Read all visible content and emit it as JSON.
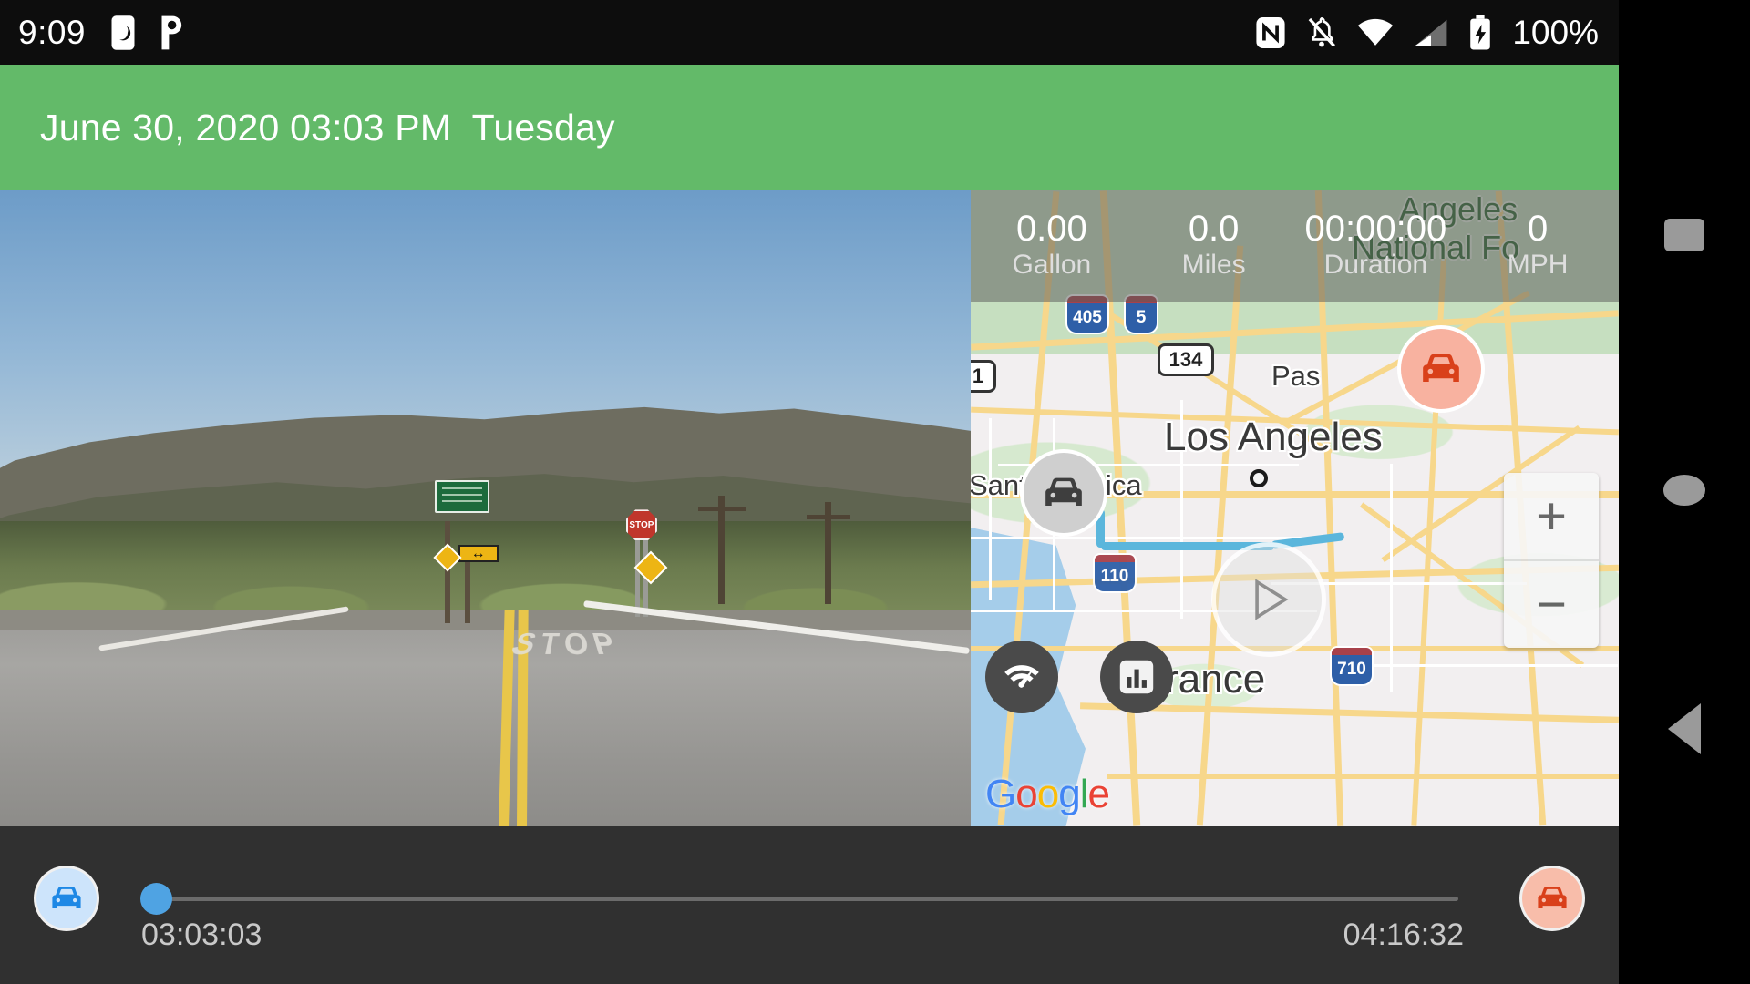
{
  "statusbar": {
    "clock": "9:09",
    "battery_percent": "100%",
    "icons": [
      "moon-dnd-box-icon",
      "pandora-icon",
      "nfc-icon",
      "notifications-off-icon",
      "wifi-icon",
      "cellular-signal-icon",
      "battery-charging-icon"
    ]
  },
  "header": {
    "datetime": "June 30, 2020 03:03 PM  Tuesday"
  },
  "stats": [
    {
      "value": "0.00",
      "label": "Gallon"
    },
    {
      "value": "0.0",
      "label": "Miles"
    },
    {
      "value": "00:00:00",
      "label": "Duration"
    },
    {
      "value": "0",
      "label": "MPH"
    }
  ],
  "map": {
    "labels": {
      "los_angeles": "Los Angeles",
      "santa_monica": "Santa Monica",
      "pasadena": "Pas",
      "torrance": "Torrance",
      "angeles": "Angeles",
      "national_forest": "National Fo"
    },
    "shields": {
      "i405": "405",
      "i5": "5",
      "i110": "110",
      "i710": "710",
      "sr134": "134",
      "us101": "1"
    },
    "watermark": {
      "g1": "G",
      "o1": "o",
      "o2": "o",
      "g2": "g",
      "l": "l",
      "e": "e"
    },
    "zoom_in": "+",
    "zoom_out": "−",
    "buttons": [
      "speedometer-button",
      "chart-button",
      "play-button",
      "zoom-in-button",
      "zoom-out-button"
    ]
  },
  "timeline": {
    "start_time": "03:03:03",
    "end_time": "04:16:32"
  },
  "navbar": {
    "recents": "recents-button",
    "home": "home-button",
    "back": "back-button"
  },
  "colors": {
    "header_green": "#63ba69",
    "bottom_bar": "#303030",
    "status_bar": "#0d0d0d",
    "thumb_blue": "#4fa3e3",
    "start_marker": "#cde4fb",
    "end_marker": "#f8bdaa",
    "car_red": "#d9401a",
    "car_blue": "#1e88e5"
  }
}
